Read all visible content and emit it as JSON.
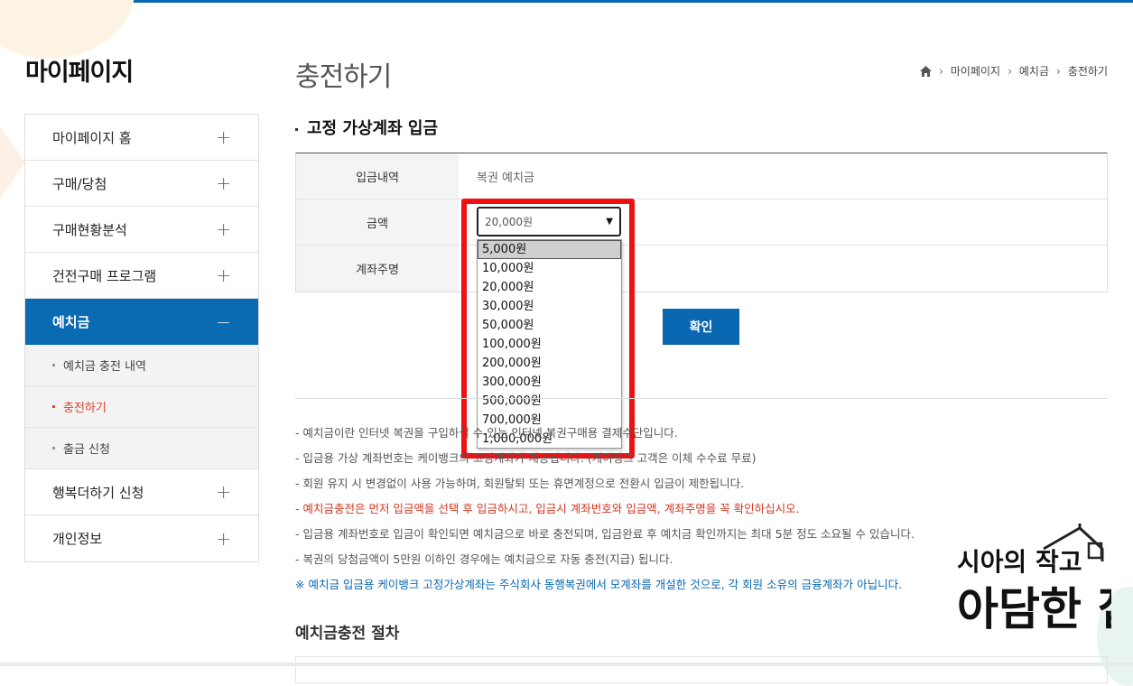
{
  "sidebar": {
    "title": "마이페이지",
    "items": [
      {
        "label": "마이페이지 홈",
        "toggle": "+"
      },
      {
        "label": "구매/당첨",
        "toggle": "+"
      },
      {
        "label": "구매현황분석",
        "toggle": "+"
      },
      {
        "label": "건전구매 프로그램",
        "toggle": "+"
      },
      {
        "label": "예치금",
        "toggle": "−"
      },
      {
        "label": "행복더하기 신청",
        "toggle": "+"
      },
      {
        "label": "개인정보",
        "toggle": "+"
      }
    ],
    "sub_items": [
      {
        "label": "예치금 충전 내역"
      },
      {
        "label": "충전하기"
      },
      {
        "label": "출금 신청"
      }
    ]
  },
  "page": {
    "title": "충전하기",
    "breadcrumb": [
      "마이페이지",
      "예치금",
      "충전하기"
    ]
  },
  "section": {
    "title": "고정 가상계좌 입금"
  },
  "form": {
    "rows": [
      {
        "label": "입금내역",
        "value": "복권 예치금"
      },
      {
        "label": "금액",
        "value": ""
      },
      {
        "label": "계좌주명",
        "value": ""
      }
    ],
    "amount_select": {
      "value": "20,000원",
      "options": [
        "5,000원",
        "10,000원",
        "20,000원",
        "30,000원",
        "50,000원",
        "100,000원",
        "200,000원",
        "300,000원",
        "500,000원",
        "700,000원",
        "1,000,000원"
      ],
      "highlighted_option": "5,000원"
    },
    "confirm_label": "확인"
  },
  "notes": [
    "-  예치금이란 인터넷 복권을 구입하실 수 있는 인터넷 복권구매용 결제수단입니다.",
    "-  입금용 가상 계좌번호는 케이뱅크의 고정계좌가 제공됩니다. (케이뱅크 고객은 이체 수수료 무료)",
    "-  회원 유지 시 변경없이 사용 가능하며, 회원탈퇴 또는 휴면계정으로 전환시 입금이 제한됩니다.",
    "-  예치금충전은 먼저 입금액을 선택 후 입금하시고, 입금시 계좌번호와 입금액, 계좌주명을 꼭 확인하십시오.",
    "-  입금용 계좌번호로 입금이 확인되면 예치금으로 바로 충전되며, 입금완료 후 예치금 확인까지는 최대 5분 정도 소요될 수 있습니다.",
    "-  복권의 당첨금액이 5만원 이하인 경우에는 예치금으로 자동 충전(지급) 됩니다.",
    "※ 예치금 입금용 케이뱅크 고정가상계좌는 주식회사 동행복권에서 모계좌를 개설한 것으로, 각 회원 소유의 금융계좌가 아닙니다."
  ],
  "procedure": {
    "title": "예치금충전 절차"
  },
  "logo": {
    "line1": "시아의 작고",
    "line2": "아담한 집"
  },
  "colors": {
    "accent": "#0a67b1",
    "warning": "#d6361f",
    "highlight_box": "#ee1111"
  },
  "icons": {
    "home": "home-icon",
    "breadcrumb_separator": "chevron-right-icon",
    "select_arrow": "triangle-down-icon"
  }
}
